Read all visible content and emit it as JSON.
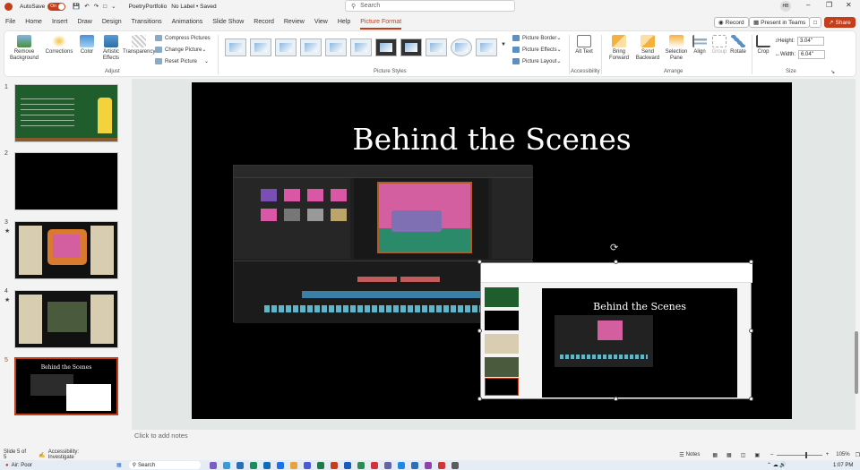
{
  "titlebar": {
    "autosave_label": "AutoSave",
    "autosave_state": "On",
    "filename": "PoetryPortfolio",
    "label_status": "No Label • Saved",
    "search_placeholder": "Search",
    "avatar_initials": "HB"
  },
  "menu": [
    "File",
    "Home",
    "Insert",
    "Draw",
    "Design",
    "Transitions",
    "Animations",
    "Slide Show",
    "Record",
    "Review",
    "View",
    "Help",
    "Picture Format"
  ],
  "menu_active_index": 12,
  "top_buttons": {
    "record": "Record",
    "present": "Present in Teams",
    "share": "Share"
  },
  "ribbon": {
    "adjust": {
      "remove_bg": "Remove Background",
      "corrections": "Corrections",
      "color": "Color",
      "artistic": "Artistic Effects",
      "transparency": "Transparency",
      "compress": "Compress Pictures",
      "change": "Change Picture",
      "reset": "Reset Picture",
      "label": "Adjust"
    },
    "styles_label": "Picture Styles",
    "border": "Picture Border",
    "effects": "Picture Effects",
    "layout": "Picture Layout",
    "accessibility": {
      "alt_text": "Alt Text",
      "label": "Accessibility"
    },
    "arrange": {
      "bring_forward": "Bring Forward",
      "send_backward": "Send Backward",
      "selection_pane": "Selection Pane",
      "align": "Align",
      "group": "Group",
      "rotate": "Rotate",
      "label": "Arrange"
    },
    "size": {
      "crop": "Crop",
      "height_label": "Height:",
      "height_value": "3.04\"",
      "width_label": "Width:",
      "width_value": "6.04\"",
      "label": "Size"
    }
  },
  "thumbnails": [
    {
      "num": "1",
      "star": false
    },
    {
      "num": "2",
      "star": false
    },
    {
      "num": "3",
      "star": true
    },
    {
      "num": "4",
      "star": true
    },
    {
      "num": "5",
      "star": false
    }
  ],
  "slide": {
    "title": "Behind the Scenes",
    "inner_title": "Behind the Scenes"
  },
  "notes_placeholder": "Click to add notes",
  "status": {
    "slide_counter": "Slide 5 of 5",
    "accessibility": "Accessibility: Investigate",
    "notes_btn": "Notes",
    "zoom": "105%"
  },
  "taskbar": {
    "weather": "Air: Poor",
    "search": "Search",
    "time": "1:07 PM"
  },
  "colors": {
    "accent": "#c43e1c",
    "chalkboard": "#1f5e2c",
    "slide_bg": "#000000"
  }
}
